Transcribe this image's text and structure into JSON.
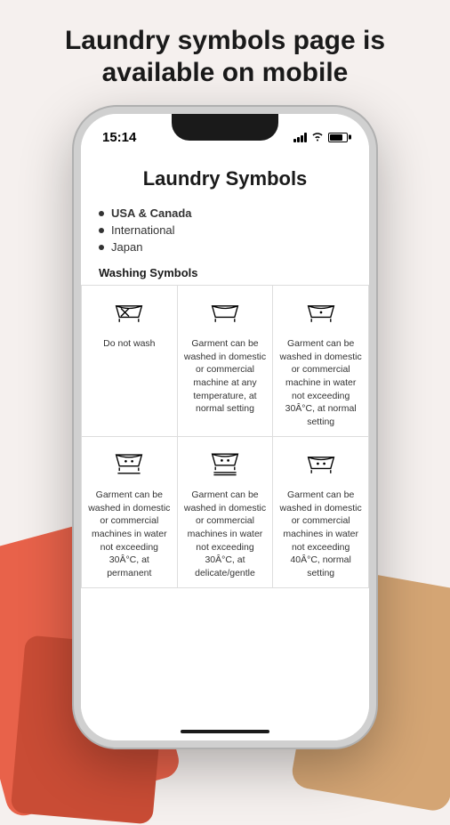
{
  "page": {
    "headline_line1": "Laundry symbols page is",
    "headline_line2": "available on mobile"
  },
  "status_bar": {
    "time": "15:14"
  },
  "app": {
    "title": "Laundry Symbols",
    "nav_items": [
      {
        "label": "USA & Canada",
        "bold": true
      },
      {
        "label": "International",
        "bold": false
      },
      {
        "label": "Japan",
        "bold": false
      }
    ],
    "section_title": "Washing Symbols",
    "symbols": [
      {
        "type": "do_not_wash",
        "description": "Do not wash"
      },
      {
        "type": "wash_any_temp",
        "description": "Garment can be washed in domestic or commercial machine at any temperature, at normal setting"
      },
      {
        "type": "wash_30_normal",
        "description": "Garment can be washed in domestic or commercial machine in water not exceeding 30Â°C, at normal setting"
      },
      {
        "type": "wash_30_perm",
        "description": "Garment can be washed in domestic or commercial machines in water not exceeding 30Â°C, at permanent"
      },
      {
        "type": "wash_30_delicate",
        "description": "Garment can be washed in domestic or commercial machines in water not exceeding 30Â°C, at delicate/gentle"
      },
      {
        "type": "wash_40_normal",
        "description": "Garment can be washed in domestic or commercial machines in water not exceeding 40Â°C, normal setting"
      }
    ]
  }
}
